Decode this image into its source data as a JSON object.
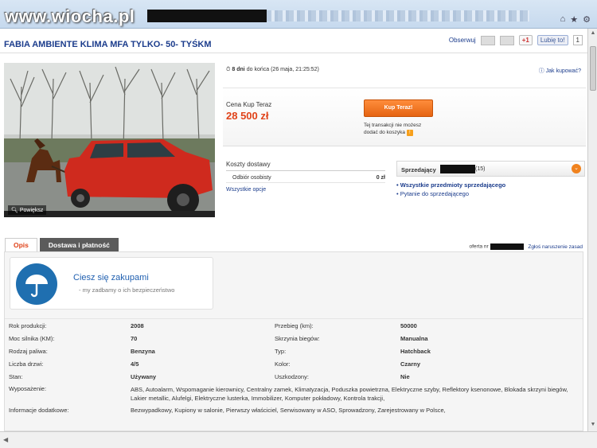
{
  "watermark": "www.wiocha.pl",
  "listing": {
    "title": "FABIA AMBIENTE KLIMA MFA TYLKO- 50- TYŚKM",
    "observe": "Obserwuj",
    "gplus": "+1",
    "fb_like": "Lubię to!",
    "fb_count": "1"
  },
  "photo": {
    "zoom": "Powiększ"
  },
  "timer": {
    "days": "8 dni",
    "rest": "do końca",
    "end": "(26 maja, 21:25:52)"
  },
  "how_to_buy": "Jak kupować?",
  "buy": {
    "label": "Cena Kup Teraz",
    "price": "28 500 zł",
    "button": "Kup Teraz!",
    "note": "Tej transakcji nie możesz dodać do koszyka"
  },
  "shipping": {
    "heading": "Koszty dostawy",
    "option": "Odbiór osobisty",
    "cost": "0 zł",
    "all": "Wszystkie opcje"
  },
  "seller": {
    "label": "Sprzedający",
    "rating": "(15)",
    "all_items": "Wszystkie przedmioty sprzedającego",
    "ask": "Pytanie do sprzedającego"
  },
  "tabs": [
    "Opis",
    "Dostawa i płatność"
  ],
  "offer": {
    "prefix": "oferta nr",
    "report": "Zgłoś naruszenie zasad"
  },
  "safety": {
    "title": "Ciesz się zakupami",
    "subtitle": "-   my zadbamy o ich bezpieczeństwo"
  },
  "params": [
    [
      "Rok produkcji:",
      "2008",
      "Przebieg (km):",
      "50000"
    ],
    [
      "Moc silnika (KM):",
      "70",
      "Skrzynia biegów:",
      "Manualna"
    ],
    [
      "Rodzaj paliwa:",
      "Benzyna",
      "Typ:",
      "Hatchback"
    ],
    [
      "Liczba drzwi:",
      "4/5",
      "Kolor:",
      "Czarny"
    ],
    [
      "Stan:",
      "Używany",
      "Uszkodzony:",
      "Nie"
    ]
  ],
  "equipment": {
    "label": "Wyposażenie:",
    "value": "ABS, Autoalarm, Wspomaganie kierownicy, Centralny zamek, Klimatyzacja, Poduszka powietrzna, Elektryczne szyby, Reflektory ksenonowe, Blokada skrzyni biegów, Lakier metallic, Alufelgi, Elektryczne lusterka, Immobilizer, Komputer pokładowy, Kontrola trakcji,"
  },
  "extra": {
    "label": "Informacje dodatkowe:",
    "value": "Bezwypadkowy, Kupiony w salonie, Pierwszy właściciel, Serwisowany w ASO, Sprowadzony, Zarejestrowany w Polsce,"
  },
  "colors": {
    "accent": "#e0431a",
    "link": "#1b3c8c",
    "button": "#f0821e"
  }
}
